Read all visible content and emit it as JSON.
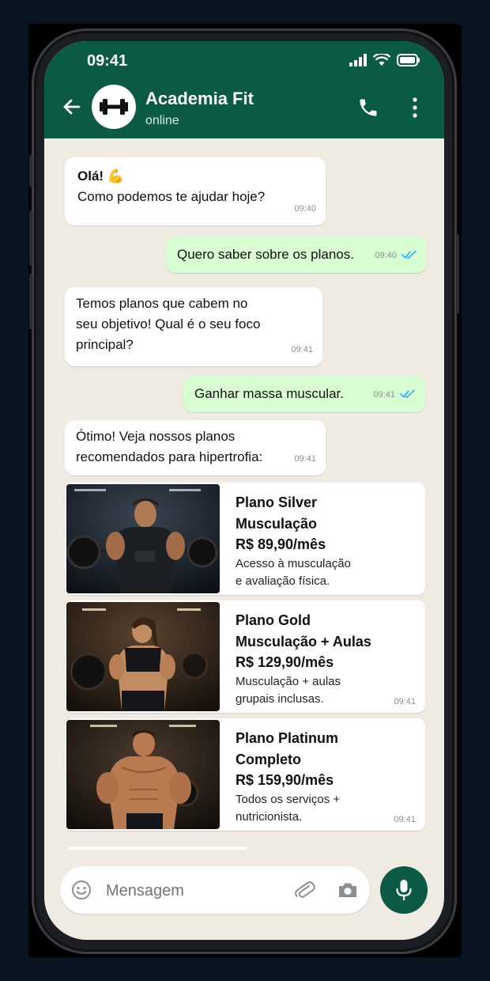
{
  "status_bar": {
    "time": "09:41"
  },
  "chat_header": {
    "contact_name": "Academia Fit",
    "contact_status": "online"
  },
  "messages": [
    {
      "direction": "in",
      "lines": [
        "Olá! 💪",
        "Como podemos te ajudar hoje?"
      ],
      "time": "09:40"
    },
    {
      "direction": "out",
      "text": "Quero saber sobre os planos.",
      "time": "09:40",
      "read": true
    },
    {
      "direction": "in",
      "lines": [
        "Temos planos que cabem no",
        "seu objetivo! Qual é o seu foco",
        "principal?"
      ],
      "time": "09:41"
    },
    {
      "direction": "out",
      "text": "Ganhar massa muscular.",
      "time": "09:41",
      "read": true
    },
    {
      "direction": "in",
      "lines": [
        "Ótimo! Veja nossos planos",
        "recomendados para hipertrofia:"
      ],
      "time": "09:41"
    }
  ],
  "plans": [
    {
      "name_lines": [
        "Plano Silver",
        "Musculação"
      ],
      "price": "R$ 89,90/mês",
      "desc_lines": [
        "Acesso à musculação",
        "e avaliação física."
      ],
      "time": ""
    },
    {
      "name_lines": [
        "Plano Gold",
        "Musculação + Aulas"
      ],
      "price": "R$ 129,90/mês",
      "desc_lines": [
        "Musculação + aulas",
        "grupais inclusas."
      ],
      "time": "09:41"
    },
    {
      "name_lines": [
        "Plano Platinum",
        "Completo"
      ],
      "price": "R$ 159,90/mês",
      "desc_lines": [
        "Todos os serviços +",
        "nutricionista."
      ],
      "time": "09:41"
    }
  ],
  "composer": {
    "placeholder": "Mensagem"
  },
  "icons": {
    "back": "arrow-left-icon",
    "avatar": "dumbbell-icon",
    "call": "phone-icon",
    "menu": "more-vertical-icon",
    "emoji": "emoji-icon",
    "attach": "paperclip-icon",
    "camera": "camera-icon",
    "mic": "microphone-icon",
    "read_receipt": "double-check-icon"
  },
  "colors": {
    "header": "#0b5a46",
    "chat_bg": "#efeae2",
    "outgoing_bubble": "#d9fdd3",
    "read_tick": "#34b7f1"
  }
}
